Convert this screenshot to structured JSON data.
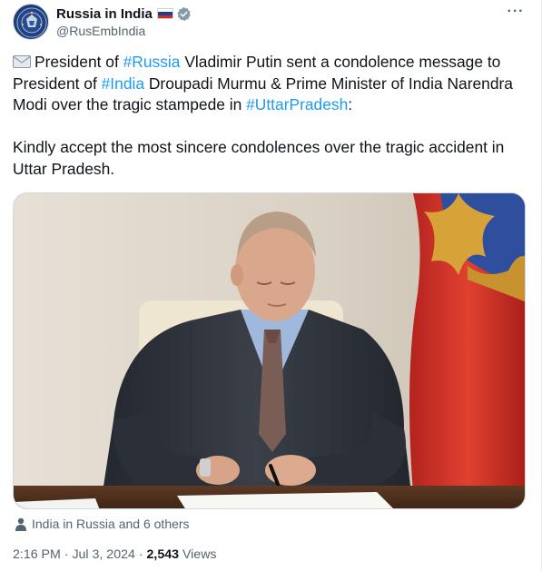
{
  "account": {
    "display_name": "Russia in India",
    "handle": "@RusEmbIndia",
    "flag_colors": [
      "#ffffff",
      "#1c3f94",
      "#d52b1e"
    ],
    "verified_icon": "verified-badge-icon",
    "avatar_icon": "embassy-emblem-icon",
    "more_label": "···"
  },
  "tweet": {
    "line1_emoji_icon": "envelope-icon",
    "line1_pre": "President of ",
    "hashtag_russia": "#Russia",
    "line1_post": " Vladimir Putin sent a condolence message to",
    "line2_pre": "President of ",
    "hashtag_india": "#India",
    "line2_post": " Droupadi Murmu & Prime Minister of India Narendra",
    "line3_pre": "Modi over the tragic stampede in ",
    "hashtag_up": "#UttarPradesh",
    "line3_post": ":",
    "line4": "Kindly accept the most sincere condolences over the tragic accident in",
    "line5": "Uttar Pradesh."
  },
  "media": {
    "icon": "photo-putin-signing-document"
  },
  "tagged": {
    "icon": "person-icon",
    "text": "India in Russia and 6 others"
  },
  "meta": {
    "time": "2:16 PM",
    "sep1": " · ",
    "date": "Jul 3, 2024",
    "sep2": " · ",
    "views_count": "2,543",
    "views_label": " Views"
  },
  "colors": {
    "accent": "#1d9bf0",
    "text": "#0f1419",
    "secondary": "#536471"
  }
}
